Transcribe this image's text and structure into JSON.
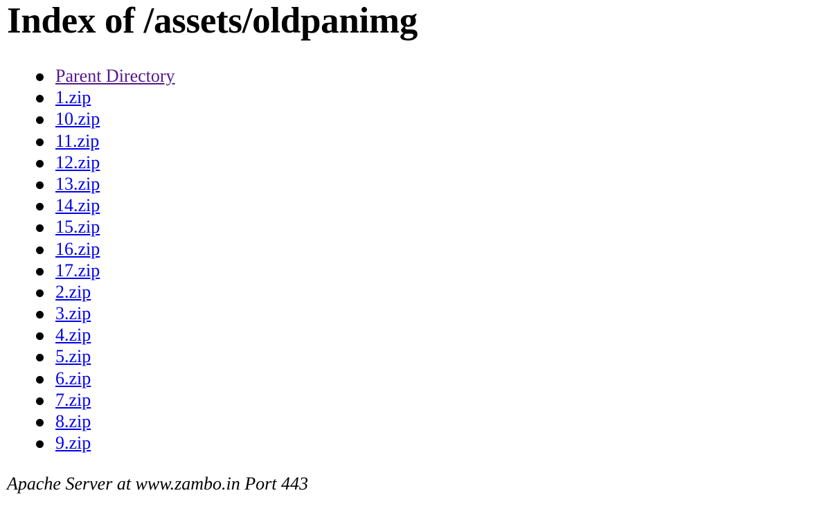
{
  "page": {
    "title": "Index of /assets/oldpanimg"
  },
  "listing": {
    "items": [
      {
        "label": "Parent Directory",
        "visited": true
      },
      {
        "label": "1.zip"
      },
      {
        "label": "10.zip"
      },
      {
        "label": "11.zip"
      },
      {
        "label": "12.zip"
      },
      {
        "label": "13.zip"
      },
      {
        "label": "14.zip"
      },
      {
        "label": "15.zip"
      },
      {
        "label": "16.zip"
      },
      {
        "label": "17.zip"
      },
      {
        "label": "2.zip"
      },
      {
        "label": "3.zip"
      },
      {
        "label": "4.zip"
      },
      {
        "label": "5.zip"
      },
      {
        "label": "6.zip"
      },
      {
        "label": "7.zip"
      },
      {
        "label": "8.zip"
      },
      {
        "label": "9.zip"
      }
    ]
  },
  "footer": {
    "signature": "Apache Server at www.zambo.in Port 443"
  },
  "colors": {
    "link": "#0000ee",
    "visited_link": "#551a8b"
  }
}
